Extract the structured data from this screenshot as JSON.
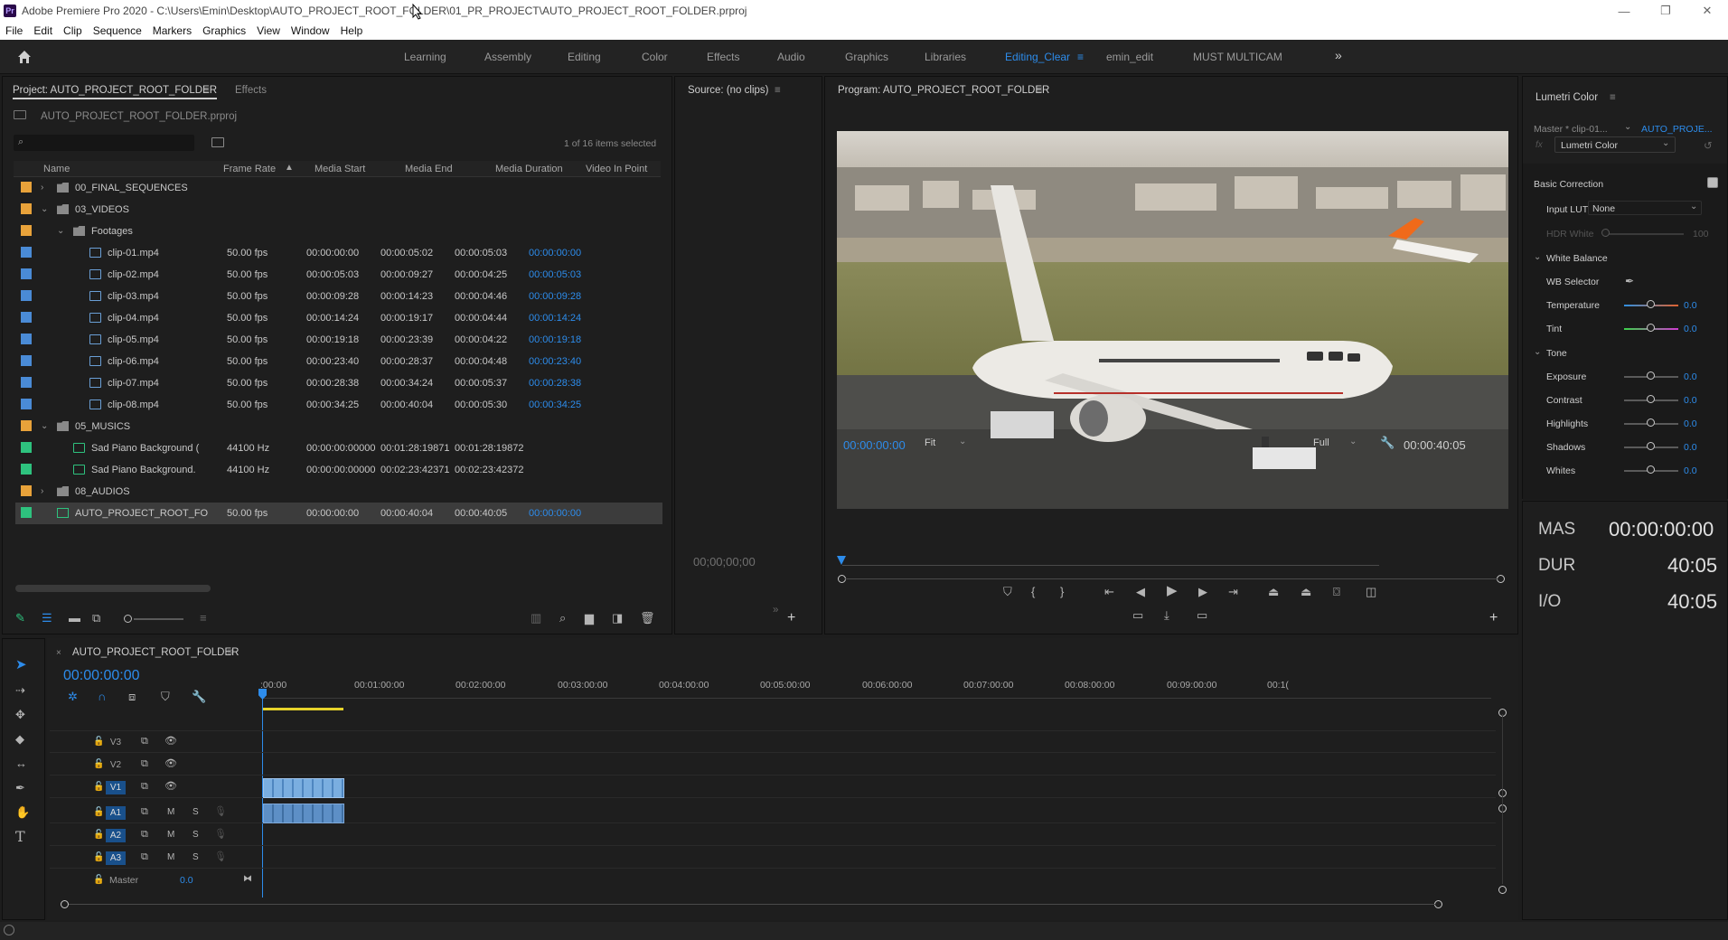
{
  "titlebar": {
    "app_badge": "Pr",
    "title": "Adobe Premiere Pro 2020 - C:\\Users\\Emin\\Desktop\\AUTO_PROJECT_ROOT_FOLDER\\01_PR_PROJECT\\AUTO_PROJECT_ROOT_FOLDER.prproj",
    "minimize": "—",
    "restore": "❐",
    "close": "✕"
  },
  "menu": [
    "File",
    "Edit",
    "Clip",
    "Sequence",
    "Markers",
    "Graphics",
    "View",
    "Window",
    "Help"
  ],
  "workspaces": {
    "tabs": [
      "Learning",
      "Assembly",
      "Editing",
      "Color",
      "Effects",
      "Audio",
      "Graphics",
      "Libraries",
      "Editing_Clear",
      "emin_edit",
      "MUST MULTICAM"
    ],
    "active": "Editing_Clear",
    "overflow": "»"
  },
  "project": {
    "tab_title": "Project: AUTO_PROJECT_ROOT_FOLDER",
    "tab_effects": "Effects",
    "filename": "AUTO_PROJECT_ROOT_FOLDER.prproj",
    "search_placeholder": "",
    "selection_count": "1 of 16 items selected",
    "columns": [
      "Name",
      "Frame Rate",
      "Media Start",
      "Media End",
      "Media Duration",
      "Video In Point"
    ],
    "rows": [
      {
        "name": "00_FINAL_SEQUENCES",
        "type": "folder",
        "indent": 1,
        "expander": ">",
        "color": "#e8a23a",
        "fps": "",
        "start": "",
        "end": "",
        "dur": "",
        "vin": ""
      },
      {
        "name": "03_VIDEOS",
        "type": "folder",
        "indent": 1,
        "expander": "v",
        "color": "#e8a23a",
        "fps": "",
        "start": "",
        "end": "",
        "dur": "",
        "vin": ""
      },
      {
        "name": "Footages",
        "type": "folder",
        "indent": 2,
        "expander": "v",
        "color": "#e8a23a",
        "fps": "",
        "start": "",
        "end": "",
        "dur": "",
        "vin": ""
      },
      {
        "name": "clip-01.mp4",
        "type": "clip",
        "indent": 3,
        "expander": "",
        "color": "#4a8bd6",
        "fps": "50.00 fps",
        "start": "00:00:00:00",
        "end": "00:00:05:02",
        "dur": "00:00:05:03",
        "vin": "00:00:00:00"
      },
      {
        "name": "clip-02.mp4",
        "type": "clip",
        "indent": 3,
        "expander": "",
        "color": "#4a8bd6",
        "fps": "50.00 fps",
        "start": "00:00:05:03",
        "end": "00:00:09:27",
        "dur": "00:00:04:25",
        "vin": "00:00:05:03"
      },
      {
        "name": "clip-03.mp4",
        "type": "clip",
        "indent": 3,
        "expander": "",
        "color": "#4a8bd6",
        "fps": "50.00 fps",
        "start": "00:00:09:28",
        "end": "00:00:14:23",
        "dur": "00:00:04:46",
        "vin": "00:00:09:28"
      },
      {
        "name": "clip-04.mp4",
        "type": "clip",
        "indent": 3,
        "expander": "",
        "color": "#4a8bd6",
        "fps": "50.00 fps",
        "start": "00:00:14:24",
        "end": "00:00:19:17",
        "dur": "00:00:04:44",
        "vin": "00:00:14:24"
      },
      {
        "name": "clip-05.mp4",
        "type": "clip",
        "indent": 3,
        "expander": "",
        "color": "#4a8bd6",
        "fps": "50.00 fps",
        "start": "00:00:19:18",
        "end": "00:00:23:39",
        "dur": "00:00:04:22",
        "vin": "00:00:19:18"
      },
      {
        "name": "clip-06.mp4",
        "type": "clip",
        "indent": 3,
        "expander": "",
        "color": "#4a8bd6",
        "fps": "50.00 fps",
        "start": "00:00:23:40",
        "end": "00:00:28:37",
        "dur": "00:00:04:48",
        "vin": "00:00:23:40"
      },
      {
        "name": "clip-07.mp4",
        "type": "clip",
        "indent": 3,
        "expander": "",
        "color": "#4a8bd6",
        "fps": "50.00 fps",
        "start": "00:00:28:38",
        "end": "00:00:34:24",
        "dur": "00:00:05:37",
        "vin": "00:00:28:38"
      },
      {
        "name": "clip-08.mp4",
        "type": "clip",
        "indent": 3,
        "expander": "",
        "color": "#4a8bd6",
        "fps": "50.00 fps",
        "start": "00:00:34:25",
        "end": "00:00:40:04",
        "dur": "00:00:05:30",
        "vin": "00:00:34:25"
      },
      {
        "name": "05_MUSICS",
        "type": "folder",
        "indent": 1,
        "expander": "v",
        "color": "#e8a23a",
        "fps": "",
        "start": "",
        "end": "",
        "dur": "",
        "vin": ""
      },
      {
        "name": "Sad Piano Background (",
        "type": "audio",
        "indent": 2,
        "expander": "",
        "color": "#2ec27e",
        "fps": "44100 Hz",
        "start": "00:00:00:00000",
        "end": "00:01:28:19871",
        "dur": "00:01:28:19872",
        "vin": ""
      },
      {
        "name": "Sad Piano Background.",
        "type": "audio",
        "indent": 2,
        "expander": "",
        "color": "#2ec27e",
        "fps": "44100 Hz",
        "start": "00:00:00:00000",
        "end": "00:02:23:42371",
        "dur": "00:02:23:42372",
        "vin": ""
      },
      {
        "name": "08_AUDIOS",
        "type": "folder",
        "indent": 1,
        "expander": ">",
        "color": "#e8a23a",
        "fps": "",
        "start": "",
        "end": "",
        "dur": "",
        "vin": ""
      },
      {
        "name": "AUTO_PROJECT_ROOT_FO",
        "type": "sequence",
        "indent": 1,
        "expander": "",
        "color": "#2ec27e",
        "fps": "50.00 fps",
        "start": "00:00:00:00",
        "end": "00:00:40:04",
        "dur": "00:00:40:05",
        "vin": "00:00:00:00",
        "selected": true
      }
    ]
  },
  "source": {
    "title": "Source: (no clips)",
    "timecode": "00;00;00;00"
  },
  "program": {
    "title": "Program: AUTO_PROJECT_ROOT_FOLDER",
    "timecode": "00:00:00:00",
    "fit": "Fit",
    "quality": "Full",
    "duration": "00:00:40:05"
  },
  "lumetri": {
    "title": "Lumetri Color",
    "master": "Master * clip-01...",
    "sequence_link": "AUTO_PROJE...",
    "effect_select": "Lumetri Color",
    "basic_correction": "Basic Correction",
    "input_lut_label": "Input LUT",
    "input_lut_value": "None",
    "hdr_white_label": "HDR White",
    "hdr_white_value": "100",
    "white_balance": "White Balance",
    "wb_selector": "WB Selector",
    "temperature_label": "Temperature",
    "temperature_value": "0.0",
    "tint_label": "Tint",
    "tint_value": "0.0",
    "tone": "Tone",
    "exposure_label": "Exposure",
    "exposure_value": "0.0",
    "contrast_label": "Contrast",
    "contrast_value": "0.0",
    "highlights_label": "Highlights",
    "highlights_value": "0.0",
    "shadows_label": "Shadows",
    "shadows_value": "0.0",
    "whites_label": "Whites",
    "whites_value": "0.0"
  },
  "info": {
    "mas_label": "MAS",
    "mas_value": "00:00:00:00",
    "dur_label": "DUR",
    "dur_value": "40:05",
    "io_label": "I/O",
    "io_value": "40:05"
  },
  "timeline": {
    "tab_title": "AUTO_PROJECT_ROOT_FOLDER",
    "timecode": "00:00:00:00",
    "ruler": [
      ":00:00",
      "00:01:00:00",
      "00:02:00:00",
      "00:03:00:00",
      "00:04:00:00",
      "00:05:00:00",
      "00:06:00:00",
      "00:07:00:00",
      "00:08:00:00",
      "00:09:00:00",
      "00:1("
    ],
    "tracks": {
      "v3": "V3",
      "v2": "V2",
      "v1": "V1",
      "a1": "A1",
      "a2": "A2",
      "a3": "A3",
      "master": "Master",
      "master_value": "0.0",
      "mute": "M",
      "solo": "S"
    }
  },
  "colors": {
    "accent": "#2d8ceb",
    "folder": "#e8a23a",
    "video": "#4a8bd6",
    "audio": "#2ec27e",
    "track_active": "#19508b"
  }
}
